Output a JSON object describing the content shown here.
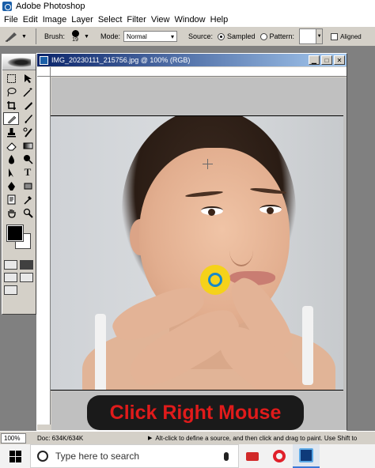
{
  "app": {
    "title": "Adobe Photoshop"
  },
  "menu": [
    "File",
    "Edit",
    "Image",
    "Layer",
    "Select",
    "Filter",
    "View",
    "Window",
    "Help"
  ],
  "options": {
    "brush_label": "Brush:",
    "brush_size": "19",
    "mode_label": "Mode:",
    "mode_value": "Normal",
    "source_label": "Source:",
    "sampled_label": "Sampled",
    "pattern_label": "Pattern:",
    "aligned_label": "Aligned",
    "source_selected": "Sampled"
  },
  "document": {
    "title": "IMG_20230111_215756.jpg @ 100% (RGB)"
  },
  "overlay": {
    "text": "Click Right Mouse"
  },
  "status": {
    "zoom": "100%",
    "doc_size": "Doc: 634K/634K",
    "hint": "Alt-click to define a source, and then click and drag to paint. Use Shift to"
  },
  "taskbar": {
    "search_placeholder": "Type here to search"
  },
  "colors": {
    "foreground": "#000000",
    "background": "#ffffff",
    "cursor_ring": "#f5d21a",
    "cursor_center": "#1688c9",
    "overlay_text": "#e01b1b"
  }
}
